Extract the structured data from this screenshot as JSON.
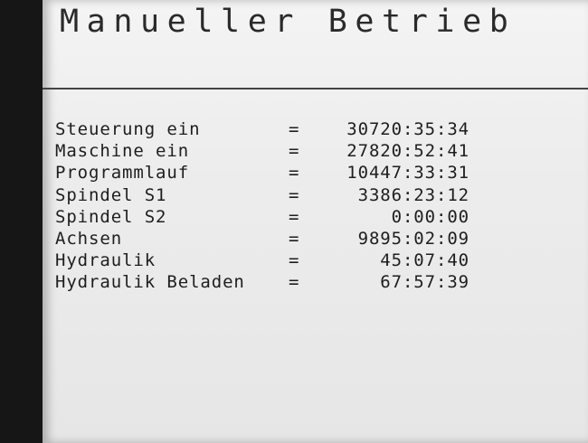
{
  "screen": {
    "title": "Manueller Betrieb"
  },
  "counters": [
    {
      "label": "Steuerung ein",
      "value": "30720:35:34"
    },
    {
      "label": "Maschine ein",
      "value": "27820:52:41"
    },
    {
      "label": "Programmlauf",
      "value": "10447:33:31"
    },
    {
      "label": "Spindel S1",
      "value": "3386:23:12"
    },
    {
      "label": "Spindel S2",
      "value": "0:00:00"
    },
    {
      "label": "Achsen",
      "value": "9895:02:09"
    },
    {
      "label": "Hydraulik",
      "value": "45:07:40"
    },
    {
      "label": "Hydraulik Beladen",
      "value": "67:57:39"
    }
  ],
  "separator": "="
}
